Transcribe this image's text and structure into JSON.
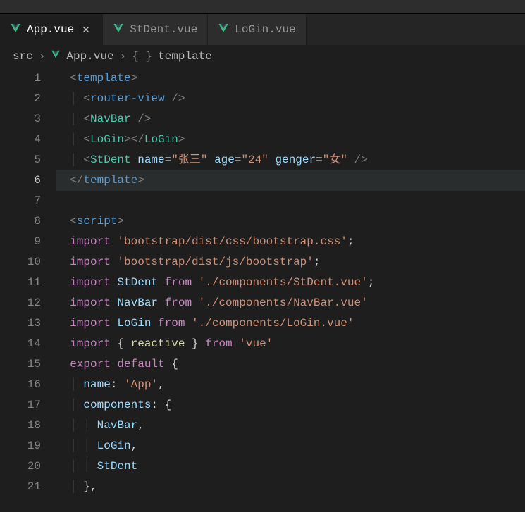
{
  "menu_partial": " ",
  "tabs": [
    {
      "label": "App.vue",
      "active": true
    },
    {
      "label": "StDent.vue",
      "active": false
    },
    {
      "label": "LoGin.vue",
      "active": false
    }
  ],
  "breadcrumb": {
    "item0": "src",
    "item1": "App.vue",
    "item2": "template"
  },
  "gutter": {
    "l1": "1",
    "l2": "2",
    "l3": "3",
    "l4": "4",
    "l5": "5",
    "l6": "6",
    "l7": "7",
    "l8": "8",
    "l9": "9",
    "l10": "10",
    "l11": "11",
    "l12": "12",
    "l13": "13",
    "l14": "14",
    "l15": "15",
    "l16": "16",
    "l17": "17",
    "l18": "18",
    "l19": "19",
    "l20": "20",
    "l21": "21"
  },
  "code": {
    "l1": {
      "p1": "<",
      "t": "template",
      "p2": ">"
    },
    "l2": {
      "p1": "<",
      "t": "router-view",
      "sp": " ",
      "p2": "/>"
    },
    "l3": {
      "p1": "<",
      "t": "NavBar",
      "sp": " ",
      "p2": "/>"
    },
    "l4": {
      "p1": "<",
      "t": "LoGin",
      "p2": "></",
      "t2": "LoGin",
      "p3": ">"
    },
    "l5": {
      "p1": "<",
      "t": "StDent",
      "a1": " name",
      "eq1": "=",
      "v1": "\"张三\"",
      "a2": " age",
      "eq2": "=",
      "v2": "\"24\"",
      "a3": " genger",
      "eq3": "=",
      "v3": "\"女\"",
      "p2": " />"
    },
    "l6": {
      "p1": "</",
      "t": "template",
      "p2": ">"
    },
    "l8": {
      "p1": "<",
      "t": "script",
      "p2": ">"
    },
    "l9": {
      "kw": "import",
      "sp": " ",
      "s": "'bootstrap/dist/css/bootstrap.css'",
      "sc": ";"
    },
    "l10": {
      "kw": "import",
      "sp": " ",
      "s": "'bootstrap/dist/js/bootstrap'",
      "sc": ";"
    },
    "l11": {
      "kw": "import",
      "sp": " ",
      "n": "StDent",
      "fr": " from ",
      "s": "'./components/StDent.vue'",
      "sc": ";"
    },
    "l12": {
      "kw": "import",
      "sp": " ",
      "n": "NavBar",
      "fr": " from ",
      "s": "'./components/NavBar.vue'"
    },
    "l13": {
      "kw": "import",
      "sp": " ",
      "n": "LoGin",
      "fr": " from ",
      "s": "'./components/LoGin.vue'"
    },
    "l14": {
      "kw": "import",
      "ob": " { ",
      "n": "reactive",
      "cb": " } ",
      "fr": "from ",
      "s": "'vue'"
    },
    "l15": {
      "kw1": "export",
      "sp": " ",
      "kw2": "default",
      "ob": " {"
    },
    "l16": {
      "k": "name",
      "c": ": ",
      "v": "'App'",
      "cm": ","
    },
    "l17": {
      "k": "components",
      "c": ": {"
    },
    "l18": {
      "n": "NavBar",
      "cm": ","
    },
    "l19": {
      "n": "LoGin",
      "cm": ","
    },
    "l20": {
      "n": "StDent"
    },
    "l21": {
      "p": "},"
    }
  }
}
